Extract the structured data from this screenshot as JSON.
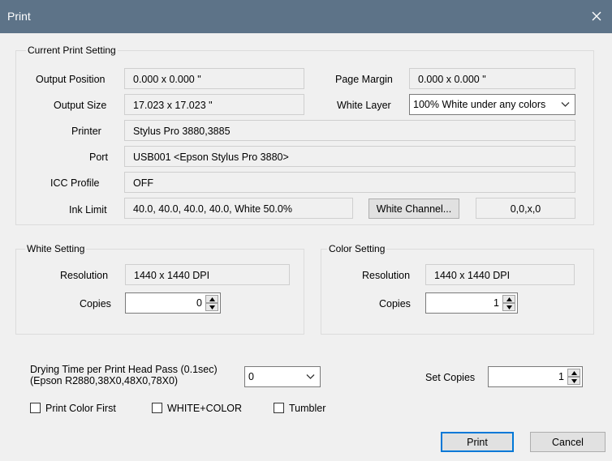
{
  "window": {
    "title": "Print",
    "close_icon": "close-icon"
  },
  "current": {
    "group_label": "Current Print Setting",
    "output_position_label": "Output Position",
    "output_position_value": "0.000 x 0.000 \"",
    "page_margin_label": "Page Margin",
    "page_margin_value": "0.000 x 0.000 \"",
    "output_size_label": "Output Size",
    "output_size_value": "17.023 x 17.023 \"",
    "white_layer_label": "White Layer",
    "white_layer_value": "100% White under any colors",
    "printer_label": "Printer",
    "printer_value": "Stylus Pro 3880,3885",
    "port_label": "Port",
    "port_value": "USB001  <Epson Stylus Pro 3880>",
    "icc_label": "ICC Profile",
    "icc_value": "OFF",
    "ink_limit_label": "Ink Limit",
    "ink_limit_value": "40.0, 40.0, 40.0, 40.0, White 50.0%",
    "white_channel_button": "White Channel...",
    "white_channel_value": "0,0,x,0"
  },
  "white_setting": {
    "group_label": "White Setting",
    "resolution_label": "Resolution",
    "resolution_value": "1440 x 1440 DPI",
    "copies_label": "Copies",
    "copies_value": "0"
  },
  "color_setting": {
    "group_label": "Color Setting",
    "resolution_label": "Resolution",
    "resolution_value": "1440 x 1440 DPI",
    "copies_label": "Copies",
    "copies_value": "1"
  },
  "drying": {
    "label_line1": "Drying Time per Print Head Pass (0.1sec)",
    "label_line2": "(Epson R2880,38X0,48X0,78X0)",
    "value": "0"
  },
  "set_copies": {
    "label": "Set Copies",
    "value": "1"
  },
  "checkboxes": {
    "print_color_first": "Print Color First",
    "white_color": "WHITE+COLOR",
    "tumbler": "Tumbler"
  },
  "buttons": {
    "print": "Print",
    "cancel": "Cancel"
  }
}
